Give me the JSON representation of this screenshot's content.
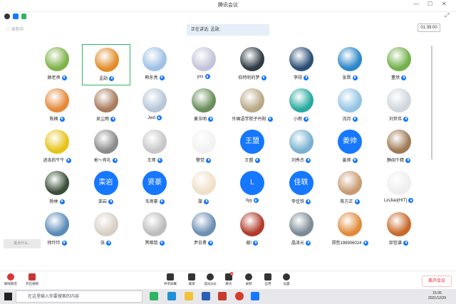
{
  "window": {
    "title": "腾讯会议"
  },
  "infobar": {
    "timer": "01:39:00",
    "recording_label": "录制中"
  },
  "speaking": {
    "label": "正在讲话: 孟勋;"
  },
  "colors": {
    "accent": "#1677ff",
    "selected_border": "#2fb463",
    "leave": "#e22233"
  },
  "participants": [
    {
      "name": "顾老师",
      "avatar": "img",
      "color": "#7fb34a"
    },
    {
      "name": "孟勋",
      "avatar": "img",
      "color": "#e28d2a",
      "selected": true
    },
    {
      "name": "韩东亮",
      "avatar": "img",
      "color": "#9fc1e6"
    },
    {
      "name": "yxs",
      "avatar": "img",
      "color": "#c4c4d8"
    },
    {
      "name": "伯特利的梦",
      "avatar": "img",
      "color": "#2f3b45"
    },
    {
      "name": "李翊",
      "avatar": "img",
      "color": "#2c4f77"
    },
    {
      "name": "张晋",
      "avatar": "img",
      "color": "#2c86c8"
    },
    {
      "name": "董然",
      "avatar": "img",
      "color": "#73b04a"
    },
    {
      "name": "陈楠",
      "avatar": "img",
      "color": "#e58a3a"
    },
    {
      "name": "吴尘雨",
      "avatar": "img",
      "color": "#a87b5c"
    },
    {
      "name": "Jwd",
      "avatar": "img",
      "color": "#b7c6d8"
    },
    {
      "name": "黄玉明",
      "avatar": "img",
      "color": "#6a8e5b"
    },
    {
      "name": "外国语学院子丹阳",
      "avatar": "img",
      "color": "#b9a886"
    },
    {
      "name": "小雨",
      "avatar": "img",
      "color": "#29aaa0"
    },
    {
      "name": "流月",
      "avatar": "img",
      "color": "#94c4e4"
    },
    {
      "name": "刘世伟",
      "avatar": "img",
      "color": "#cfd6dc"
    },
    {
      "name": "进击的牛牛",
      "avatar": "img",
      "color": "#e6c318"
    },
    {
      "name": "彬～有礼",
      "avatar": "img",
      "color": "#8b8b8b"
    },
    {
      "name": "王帅",
      "avatar": "img",
      "color": "#c7c7c7"
    },
    {
      "name": "警觉",
      "avatar": "img",
      "color": "#f2f2f2"
    },
    {
      "name": "王盟",
      "avatar": "text",
      "text": "王盟"
    },
    {
      "name": "刘秀杰",
      "avatar": "img",
      "color": "#78b1d2"
    },
    {
      "name": "姜帅",
      "avatar": "text",
      "text": "姜帅"
    },
    {
      "name": "静阅千精",
      "avatar": "img",
      "color": "#9e7a55"
    },
    {
      "name": "杨林",
      "avatar": "img",
      "color": "#3a4f38"
    },
    {
      "name": "栾岩",
      "avatar": "text",
      "text": "栾岩"
    },
    {
      "name": "韦贤豪",
      "avatar": "text",
      "text": "贤豪"
    },
    {
      "name": "璇",
      "avatar": "img",
      "color": "#f0e0c8"
    },
    {
      "name": "llyy",
      "avatar": "text",
      "text": "L"
    },
    {
      "name": "李佳铁",
      "avatar": "text",
      "text": "佳轶"
    },
    {
      "name": "陈方正",
      "avatar": "img",
      "color": "#c99b72"
    },
    {
      "name": "LinJiao[HIT]",
      "avatar": "img",
      "color": "#eeeeee"
    },
    {
      "name": "徐玲玲",
      "avatar": "img",
      "color": "#5a8bb8"
    },
    {
      "name": "张",
      "avatar": "img",
      "color": "#d8cfc4"
    },
    {
      "name": "黑暗鼠",
      "avatar": "img",
      "color": "#bdbdbd"
    },
    {
      "name": "尹日勇",
      "avatar": "img",
      "color": "#6c8fb3"
    },
    {
      "name": "敲!",
      "avatar": "img",
      "color": "#b23a2a"
    },
    {
      "name": "晶泽元",
      "avatar": "img",
      "color": "#7b8a95"
    },
    {
      "name": "郑哲198906024",
      "avatar": "img",
      "color": "#e18b3a"
    },
    {
      "name": "邱信谱",
      "avatar": "img",
      "color": "#c86a2a"
    }
  ],
  "chat": {
    "placeholder": "说点什么..."
  },
  "toolbar": {
    "mute_label": "解除静音",
    "video_label": "开启视频",
    "share_label": "共享屏幕",
    "invite_label": "邀请",
    "members_label": "成员(83)",
    "chat_label": "聊天",
    "chat_badge": "3",
    "record_label": "录制",
    "apps_label": "应用",
    "settings_label": "设置",
    "leave_label": "离开会议"
  },
  "taskbar": {
    "search_placeholder": "在这里输入你要搜索的内容",
    "time": "15:35",
    "date": "2021/12/29"
  }
}
